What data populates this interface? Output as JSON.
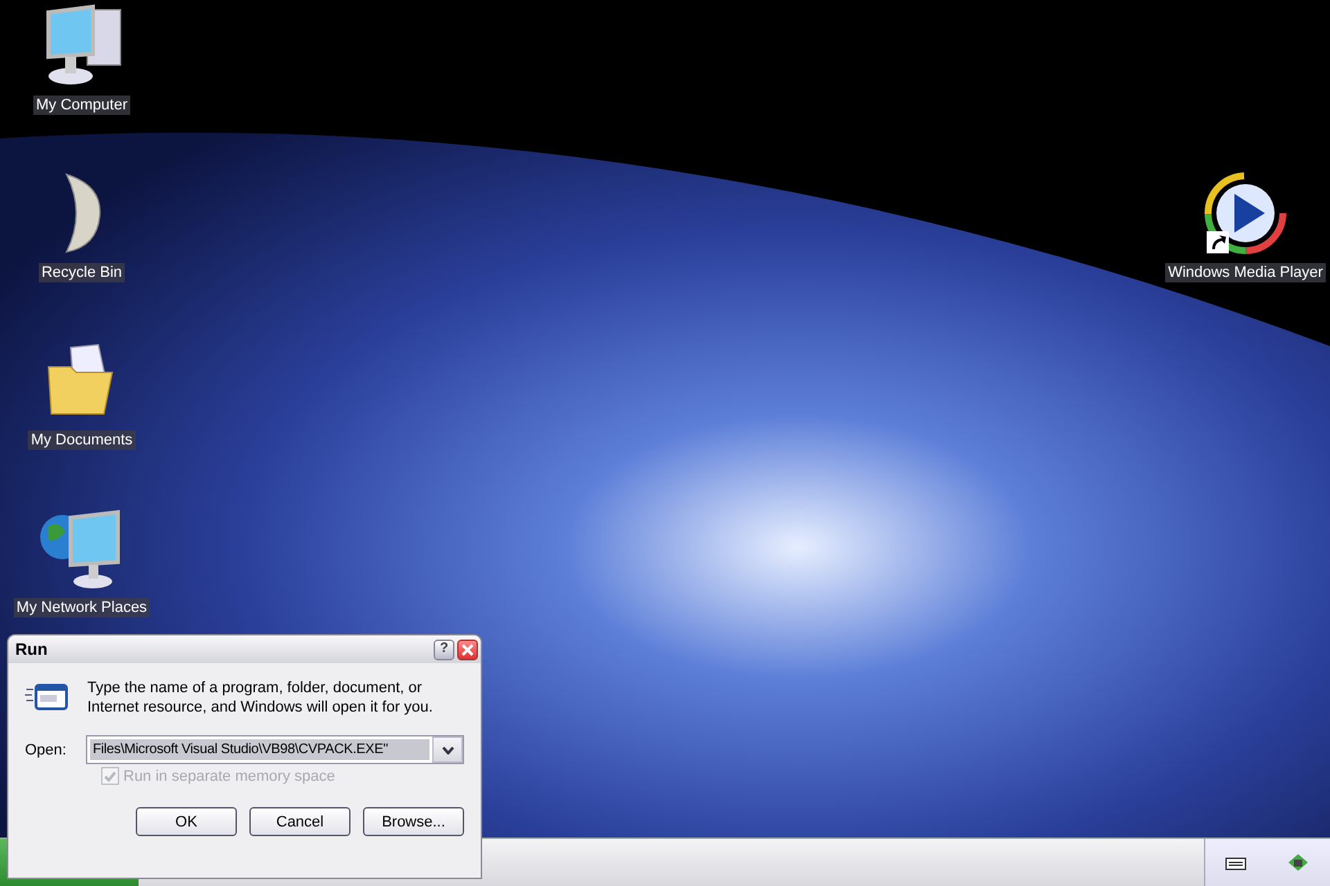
{
  "desktop_icons": [
    {
      "label": "My Computer",
      "kind": "computer",
      "shortcut": false
    },
    {
      "label": "Recycle Bin",
      "kind": "moon",
      "shortcut": false
    },
    {
      "label": "My Documents",
      "kind": "documents",
      "shortcut": false
    },
    {
      "label": "My Network Places",
      "kind": "network",
      "shortcut": false
    }
  ],
  "right_icons": [
    {
      "label": "Windows Media Player",
      "kind": "player",
      "shortcut": true
    }
  ],
  "run_dialog": {
    "title": "Run",
    "help_button": "?",
    "description": "Type the name of a program, folder, document, or Internet resource, and Windows will open it for you.",
    "open_label": "Open:",
    "open_value": "Files\\Microsoft Visual Studio\\VB98\\CVPACK.EXE\"",
    "checkbox": {
      "label": "Run in separate memory space",
      "checked": true,
      "disabled": true
    },
    "buttons": [
      "OK",
      "Cancel",
      "Browse..."
    ]
  }
}
